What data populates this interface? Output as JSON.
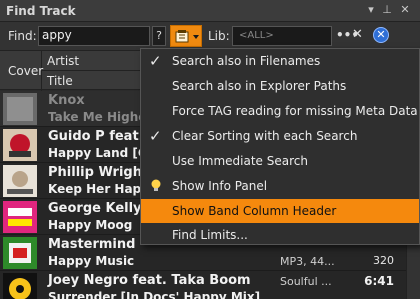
{
  "window": {
    "title": "Find Track"
  },
  "find": {
    "label": "Find:",
    "value": "appy",
    "help_label": "?"
  },
  "library": {
    "label": "Lib:",
    "placeholder": "<ALL>",
    "more_label": "•••",
    "clear_label": "✕"
  },
  "columns": {
    "cover": "Cover",
    "artist": "Artist",
    "title": "Title"
  },
  "tracks": [
    {
      "artist": "Knox",
      "title": "Take Me Higher",
      "meta": "",
      "meta2": "",
      "r1": "",
      "r2": ""
    },
    {
      "artist": "Guido P feat. J",
      "title": "Happy Land [Gui",
      "meta": "",
      "meta2": "",
      "r1": "",
      "r2": ""
    },
    {
      "artist": "Phillip Wright",
      "title": "Keep Her Happy",
      "meta": "",
      "meta2": "",
      "r1": "",
      "r2": ""
    },
    {
      "artist": "George Kelly",
      "title": "Happy Moog",
      "meta": "",
      "meta2": "",
      "r1": "",
      "r2": ""
    },
    {
      "artist": "Mastermind",
      "title": "Happy Music",
      "meta": "",
      "meta2": "MP3, 44...",
      "r1": "",
      "r2": "320"
    },
    {
      "artist": "Joey Negro feat. Taka Boom",
      "title": "Surrender [Jn Docs' Happy Mix]",
      "meta": "Soulful ...",
      "meta2": "",
      "r1": "6:41",
      "r2": ""
    }
  ],
  "menu": {
    "items": [
      {
        "label": "Search also in Filenames",
        "checked": true
      },
      {
        "label": "Search also in Explorer Paths",
        "checked": false
      },
      {
        "label": "Force TAG reading for missing Meta Data",
        "checked": false
      },
      {
        "label": "Clear Sorting with each Search",
        "checked": true
      },
      {
        "label": "Use Immediate Search",
        "checked": false
      },
      {
        "label": "Show Info Panel",
        "checked": false,
        "icon": "lightbulb-icon"
      },
      {
        "label": "Show Band Column Header",
        "checked": false,
        "highlighted": true
      },
      {
        "label": "Find Limits...",
        "checked": false
      }
    ]
  },
  "colors": {
    "accent": "#f5890d",
    "background": "#2b2b2b",
    "go_button": "#2f6fd6"
  }
}
